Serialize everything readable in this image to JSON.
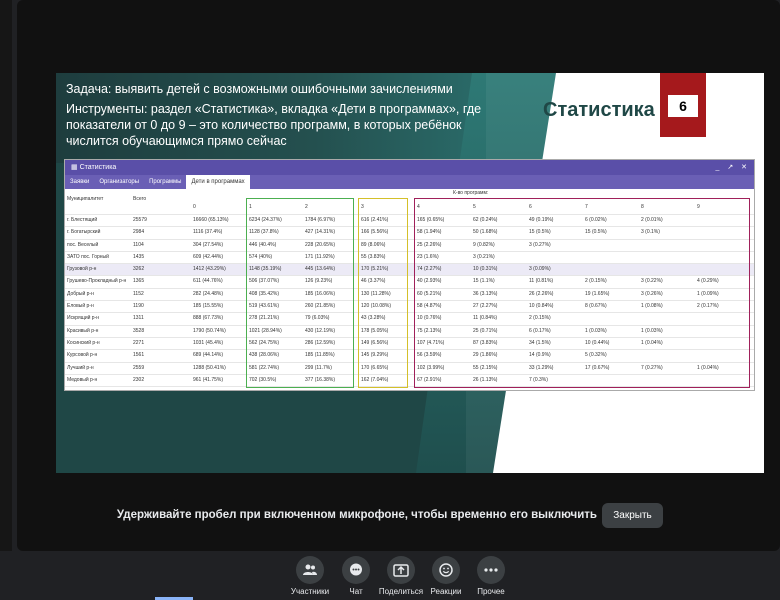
{
  "slide": {
    "task": "Задача: выявить детей с возможными ошибочными зачислениями",
    "tools": "Инструменты: раздел «Статистика», вкладка «Дети в программах», где показатели от 0 до 9 – это количество программ, в которых ребёнок числится обучающимся прямо сейчас",
    "title": "Статистика",
    "number": "6"
  },
  "window": {
    "title": "Статистика",
    "controls": "_ ↗ ✕",
    "tabs": [
      "Заявки",
      "Организаторы",
      "Программы",
      "Дети в программах"
    ],
    "group_header": "К-во программ:",
    "col_municipality": "Муниципалитет",
    "col_total": "Всего",
    "col_numbers": [
      "0",
      "1",
      "2",
      "3",
      "4",
      "5",
      "6",
      "7",
      "8",
      "9"
    ],
    "rows": [
      {
        "name": "г. Блестящий",
        "total": "25579",
        "c": [
          "16660 (65.13%)",
          "6234 (24.37%)",
          "1784 (6.97%)",
          "616 (2.41%)",
          "165 (0.65%)",
          "62 (0.24%)",
          "49 (0.19%)",
          "6 (0.02%)",
          "2 (0.01%)",
          ""
        ]
      },
      {
        "name": "г. Богатырский",
        "total": "2984",
        "c": [
          "1116 (37.4%)",
          "1128 (37.8%)",
          "427 (14.31%)",
          "166 (5.56%)",
          "58 (1.94%)",
          "50 (1.68%)",
          "15 (0.5%)",
          "15 (0.5%)",
          "3 (0.1%)",
          ""
        ]
      },
      {
        "name": "пос. Веселый",
        "total": "1104",
        "c": [
          "304 (27.54%)",
          "446 (40.4%)",
          "228 (20.65%)",
          "89 (8.06%)",
          "25 (2.26%)",
          "9 (0.82%)",
          "3 (0.27%)",
          "",
          "",
          ""
        ]
      },
      {
        "name": "ЗАТО пос. Горный",
        "total": "1435",
        "c": [
          "609 (42.44%)",
          "574 (40%)",
          "171 (11.92%)",
          "55 (3.83%)",
          "23 (1.6%)",
          "3 (0.21%)",
          "",
          "",
          "",
          ""
        ]
      },
      {
        "name": "Грузовой р-н",
        "total": "3262",
        "c": [
          "1412 (43.29%)",
          "1148 (35.19%)",
          "445 (13.64%)",
          "170 (5.21%)",
          "74 (2.27%)",
          "10 (0.31%)",
          "3 (0.09%)",
          "",
          "",
          ""
        ]
      },
      {
        "name": "Грушево-Прокладный р-н",
        "total": "1365",
        "c": [
          "611 (44.76%)",
          "506 (37.07%)",
          "126 (9.23%)",
          "46 (3.37%)",
          "40 (2.93%)",
          "15 (1.1%)",
          "11 (0.81%)",
          "2 (0.15%)",
          "3 (0.22%)",
          "4 (0.29%)"
        ]
      },
      {
        "name": "Добрый р-н",
        "total": "1152",
        "c": [
          "282 (24.48%)",
          "408 (35.42%)",
          "185 (16.06%)",
          "130 (11.28%)",
          "60 (5.21%)",
          "36 (3.13%)",
          "26 (2.26%)",
          "19 (1.65%)",
          "3 (0.26%)",
          "1 (0.09%)"
        ]
      },
      {
        "name": "Еловый р-н",
        "total": "1190",
        "c": [
          "185 (15.55%)",
          "519 (43.61%)",
          "260 (21.85%)",
          "120 (10.08%)",
          "58 (4.87%)",
          "27 (2.27%)",
          "10 (0.84%)",
          "8 (0.67%)",
          "1 (0.08%)",
          "2 (0.17%)"
        ]
      },
      {
        "name": "Искрящий р-н",
        "total": "1311",
        "c": [
          "888 (67.73%)",
          "278 (21.21%)",
          "79 (6.03%)",
          "43 (3.28%)",
          "10 (0.76%)",
          "11 (0.84%)",
          "2 (0.15%)",
          "",
          "",
          ""
        ]
      },
      {
        "name": "Красивый р-н",
        "total": "3528",
        "c": [
          "1790 (50.74%)",
          "1021 (28.94%)",
          "430 (12.19%)",
          "178 (5.05%)",
          "75 (2.13%)",
          "25 (0.71%)",
          "6 (0.17%)",
          "1 (0.03%)",
          "1 (0.03%)",
          ""
        ]
      },
      {
        "name": "Косинский р-н",
        "total": "2271",
        "c": [
          "1031 (45.4%)",
          "562 (24.75%)",
          "286 (12.59%)",
          "149 (6.56%)",
          "107 (4.71%)",
          "87 (3.83%)",
          "34 (1.5%)",
          "10 (0.44%)",
          "1 (0.04%)",
          ""
        ]
      },
      {
        "name": "Курсовой р-н",
        "total": "1561",
        "c": [
          "689 (44.14%)",
          "438 (28.06%)",
          "185 (11.85%)",
          "145 (9.29%)",
          "56 (3.59%)",
          "29 (1.86%)",
          "14 (0.9%)",
          "5 (0.32%)",
          "",
          ""
        ]
      },
      {
        "name": "Лучший р-н",
        "total": "2559",
        "c": [
          "1288 (50.41%)",
          "581 (22.74%)",
          "299 (11.7%)",
          "170 (6.65%)",
          "102 (3.99%)",
          "55 (2.15%)",
          "33 (1.29%)",
          "17 (0.67%)",
          "7 (0.27%)",
          "1 (0.04%)"
        ]
      },
      {
        "name": "Медовый р-н",
        "total": "2302",
        "c": [
          "961 (41.75%)",
          "702 (30.5%)",
          "377 (16.38%)",
          "162 (7.04%)",
          "67 (2.91%)",
          "26 (1.13%)",
          "7 (0.3%)",
          "",
          "",
          ""
        ]
      }
    ]
  },
  "meeting": {
    "caption": "Удерживайте пробел при включенном микрофоне, чтобы временно его выключить",
    "close_label": "Закрыть",
    "buttons": [
      {
        "label": "Участники",
        "icon": "people-icon"
      },
      {
        "label": "Чат",
        "icon": "chat-icon"
      },
      {
        "label": "Поделиться",
        "icon": "share-screen-icon"
      },
      {
        "label": "Реакции",
        "icon": "smile-icon"
      },
      {
        "label": "Прочее",
        "icon": "more-icon"
      }
    ]
  },
  "colors": {
    "box_green": "#4caf50",
    "box_yellow": "#d4c02a",
    "box_magenta": "#a0205a",
    "badge": "#a5191c",
    "window_titlebar": "#5a4fa8"
  }
}
